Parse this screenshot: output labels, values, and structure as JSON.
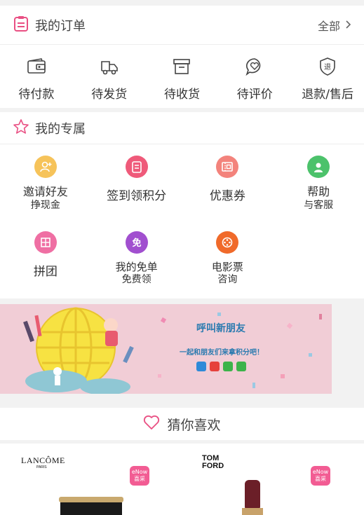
{
  "orders": {
    "title": "我的订单",
    "all_label": "全部",
    "items": [
      {
        "label": "待付款"
      },
      {
        "label": "待发货"
      },
      {
        "label": "待收货"
      },
      {
        "label": "待评价"
      },
      {
        "label": "退款/售后"
      }
    ],
    "refund_icon_char": "退"
  },
  "exclusive": {
    "title": "我的专属",
    "items": [
      {
        "line1": "邀请好友",
        "line2": "挣现金",
        "color": "#f6c35a"
      },
      {
        "line1": "签到领积分",
        "line2": "",
        "color": "#ef5a7a"
      },
      {
        "line1": "优惠券",
        "line2": "",
        "color": "#f3837c"
      },
      {
        "line1": "帮助",
        "line2": "与客服",
        "color": "#4cc26b"
      },
      {
        "line1": "拼团",
        "line2": "",
        "color": "#ef6fa3"
      },
      {
        "line1": "我的免单",
        "line2": "免费领",
        "color": "#a14fcf"
      },
      {
        "line1": "电影票",
        "line2": "咨询",
        "color": "#f06a2a"
      }
    ],
    "free_icon_char": "免"
  },
  "banner": {
    "title": "呼叫新朋友",
    "subtitle": "一起和朋友们来拿积分吧！"
  },
  "guess": {
    "title": "猜你喜欢"
  },
  "products": [
    {
      "brand": "LANCÔME",
      "brand_sub": "PARIS",
      "badge": "eNow 喜采"
    },
    {
      "brand": "TOM FORD",
      "badge": "eNow 喜采"
    }
  ],
  "colors": {
    "accent": "#e94f83",
    "badge": "#f25c93"
  }
}
